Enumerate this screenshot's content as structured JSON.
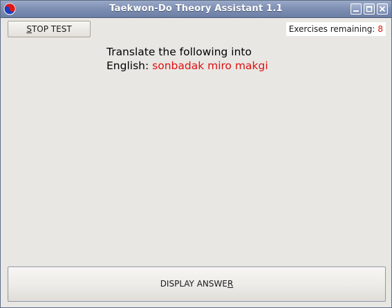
{
  "window": {
    "title": "Taekwon-Do Theory Assistant 1.1"
  },
  "toolbar": {
    "stop_label_mnemonic": "S",
    "stop_label_rest": "TOP TEST",
    "remaining_label": "Exercises remaining:",
    "remaining_count": "8"
  },
  "question": {
    "line1": "Translate the following into",
    "line2_prefix": "English:",
    "term": "sonbadak miro makgi"
  },
  "answer_button": {
    "label_start": "DISPLAY ANSWE",
    "label_mnemonic": "R"
  },
  "colors": {
    "accent_red": "#e01010",
    "window_bg": "#e9e7e3",
    "titlebar": "#7f90b4"
  },
  "icons": {
    "app": "taegeuk-icon",
    "minimize": "minimize-icon",
    "maximize": "maximize-icon",
    "close": "close-icon"
  }
}
